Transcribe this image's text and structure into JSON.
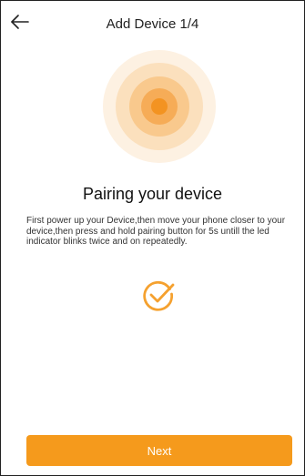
{
  "header": {
    "title": "Add Device 1/4",
    "back_icon": "arrow-left-icon"
  },
  "illustration": {
    "icon": "pairing-signal-icon",
    "colors": [
      "#fdf1e2",
      "#fbe0bd",
      "#f9c98d",
      "#f6ac57",
      "#f39321"
    ]
  },
  "content": {
    "heading": "Pairing your device",
    "instructions": "First power up your Device,then move your phone closer to your device,then press and hold pairing button for 5s untill the led indicator blinks twice and on repeatedly.",
    "check_icon": "checkmark-circle-icon"
  },
  "footer": {
    "next_label": "Next"
  },
  "colors": {
    "accent": "#f59a1c",
    "text": "#222222"
  }
}
